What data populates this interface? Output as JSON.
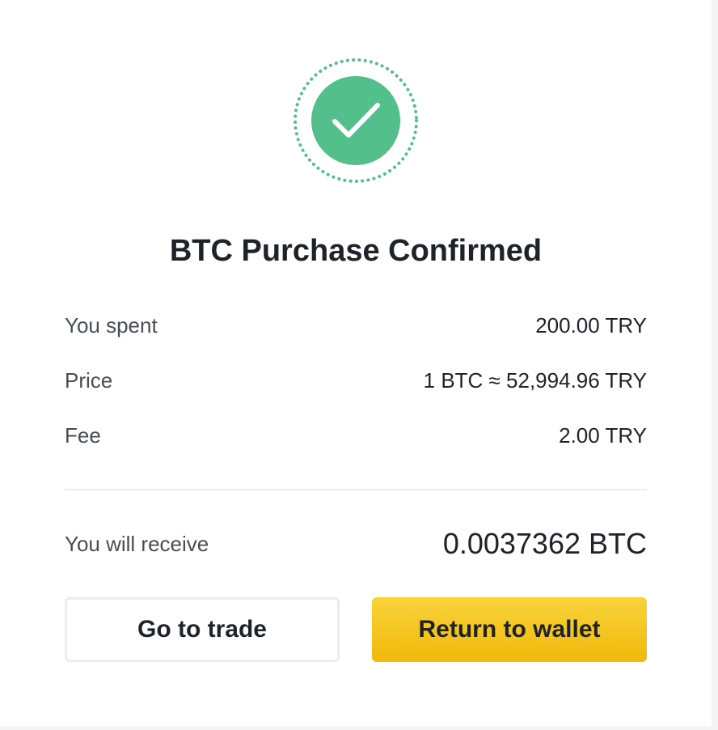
{
  "header": {
    "title": "BTC Purchase Confirmed"
  },
  "icons": {
    "success": "check-circle-icon"
  },
  "colors": {
    "success_green": "#53bf8a",
    "primary_yellow": "#f0b90b",
    "text_primary": "#1e2329",
    "text_secondary": "#474d57"
  },
  "details": [
    {
      "label": "You spent",
      "value": "200.00 TRY"
    },
    {
      "label": "Price",
      "value": "1 BTC ≈ 52,994.96 TRY"
    },
    {
      "label": "Fee",
      "value": "2.00 TRY"
    }
  ],
  "summary": {
    "label": "You will receive",
    "value": "0.0037362 BTC"
  },
  "actions": {
    "secondary_label": "Go to trade",
    "primary_label": "Return to wallet"
  }
}
